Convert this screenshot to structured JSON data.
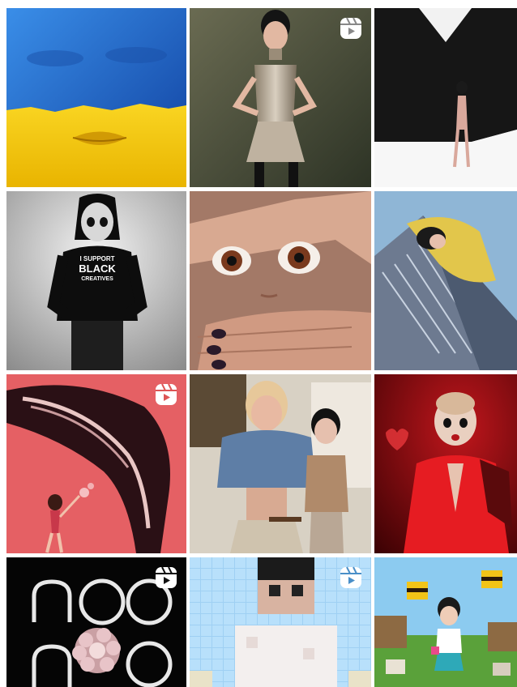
{
  "grid": {
    "posts": [
      {
        "name": "post-ukraine-flag-face",
        "is_reel": false
      },
      {
        "name": "post-metallic-dress",
        "is_reel": true
      },
      {
        "name": "post-white-room",
        "is_reel": false
      },
      {
        "name": "post-black-hoodie",
        "is_reel": false,
        "hoodie_text": [
          "I SUPPORT",
          "BLACK",
          "CREATIVES"
        ]
      },
      {
        "name": "post-hand-frame-closeup",
        "is_reel": false
      },
      {
        "name": "post-skyscraper",
        "is_reel": false
      },
      {
        "name": "post-whale-swim",
        "is_reel": true
      },
      {
        "name": "post-with-friend",
        "is_reel": false
      },
      {
        "name": "post-red-suit",
        "is_reel": false
      },
      {
        "name": "post-noonoouri-logo-flower",
        "is_reel": true
      },
      {
        "name": "post-pixelated",
        "is_reel": true
      },
      {
        "name": "post-minecraft",
        "is_reel": false
      }
    ],
    "reel_icon": "reels-icon",
    "colors": {
      "ukraine_blue": "#1e5bc6",
      "ukraine_yellow": "#f7cf14",
      "accent_red": "#e8373b"
    }
  }
}
